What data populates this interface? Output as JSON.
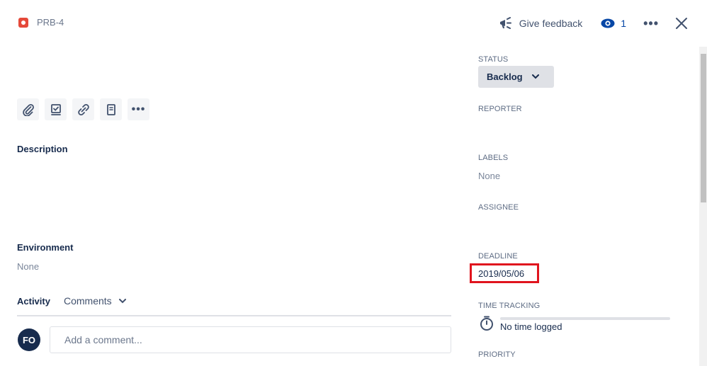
{
  "header": {
    "issue_key": "PRB-4",
    "feedback_label": "Give feedback",
    "watchers_count": "1"
  },
  "main": {
    "description_title": "Description",
    "environment_title": "Environment",
    "environment_value": "None",
    "activity_label": "Activity",
    "activity_filter": "Comments",
    "avatar_initials": "FO",
    "comment_placeholder": "Add a comment..."
  },
  "sidebar": {
    "status_label": "STATUS",
    "status_value": "Backlog",
    "reporter_label": "REPORTER",
    "labels_label": "LABELS",
    "labels_value": "None",
    "assignee_label": "ASSIGNEE",
    "deadline_label": "DEADLINE",
    "deadline_value": "2019/05/06",
    "time_tracking_label": "TIME TRACKING",
    "time_tracking_value": "No time logged",
    "time_tracking_progress": 0,
    "priority_label": "PRIORITY"
  },
  "icons": {
    "issue_type": "bug-icon",
    "feedback": "megaphone-icon",
    "watch": "eye-icon",
    "more": "more-icon",
    "close": "close-icon",
    "attach": "paperclip-icon",
    "subtask": "checkbox-icon",
    "link": "link-icon",
    "page": "document-icon",
    "clock": "stopwatch-icon"
  },
  "colors": {
    "bug": "#e5493a",
    "watch": "#0747a6",
    "highlight": "#e0141e",
    "progress": "#0065ff"
  }
}
